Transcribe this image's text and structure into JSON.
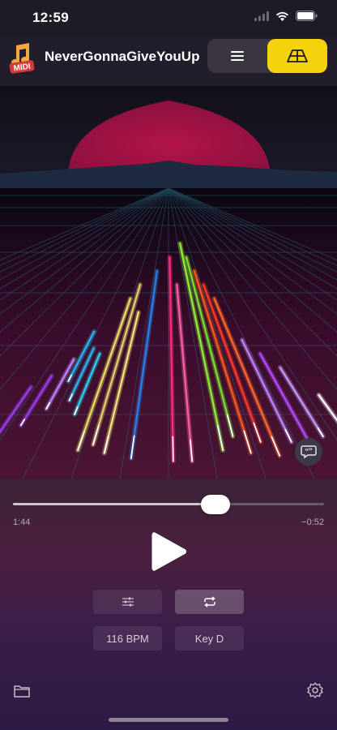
{
  "status": {
    "time": "12:59"
  },
  "header": {
    "title": "NeverGonnaGiveYouUp",
    "app_icon_text": "MIDI",
    "view_toggle": {
      "list": "list-icon",
      "perspective": "perspective-icon",
      "selected": "perspective"
    },
    "accent": "#f5d30c"
  },
  "player": {
    "elapsed": "1:44",
    "remaining": "−0:52",
    "progress": 0.65,
    "tempo": "116 BPM",
    "key": "Key D"
  },
  "icons": {
    "mixer": "sliders-icon",
    "loop": "repeat-icon",
    "lyrics": "quote-bubble-icon",
    "folder": "folder-icon",
    "settings": "gear-icon",
    "play": "play-icon"
  }
}
